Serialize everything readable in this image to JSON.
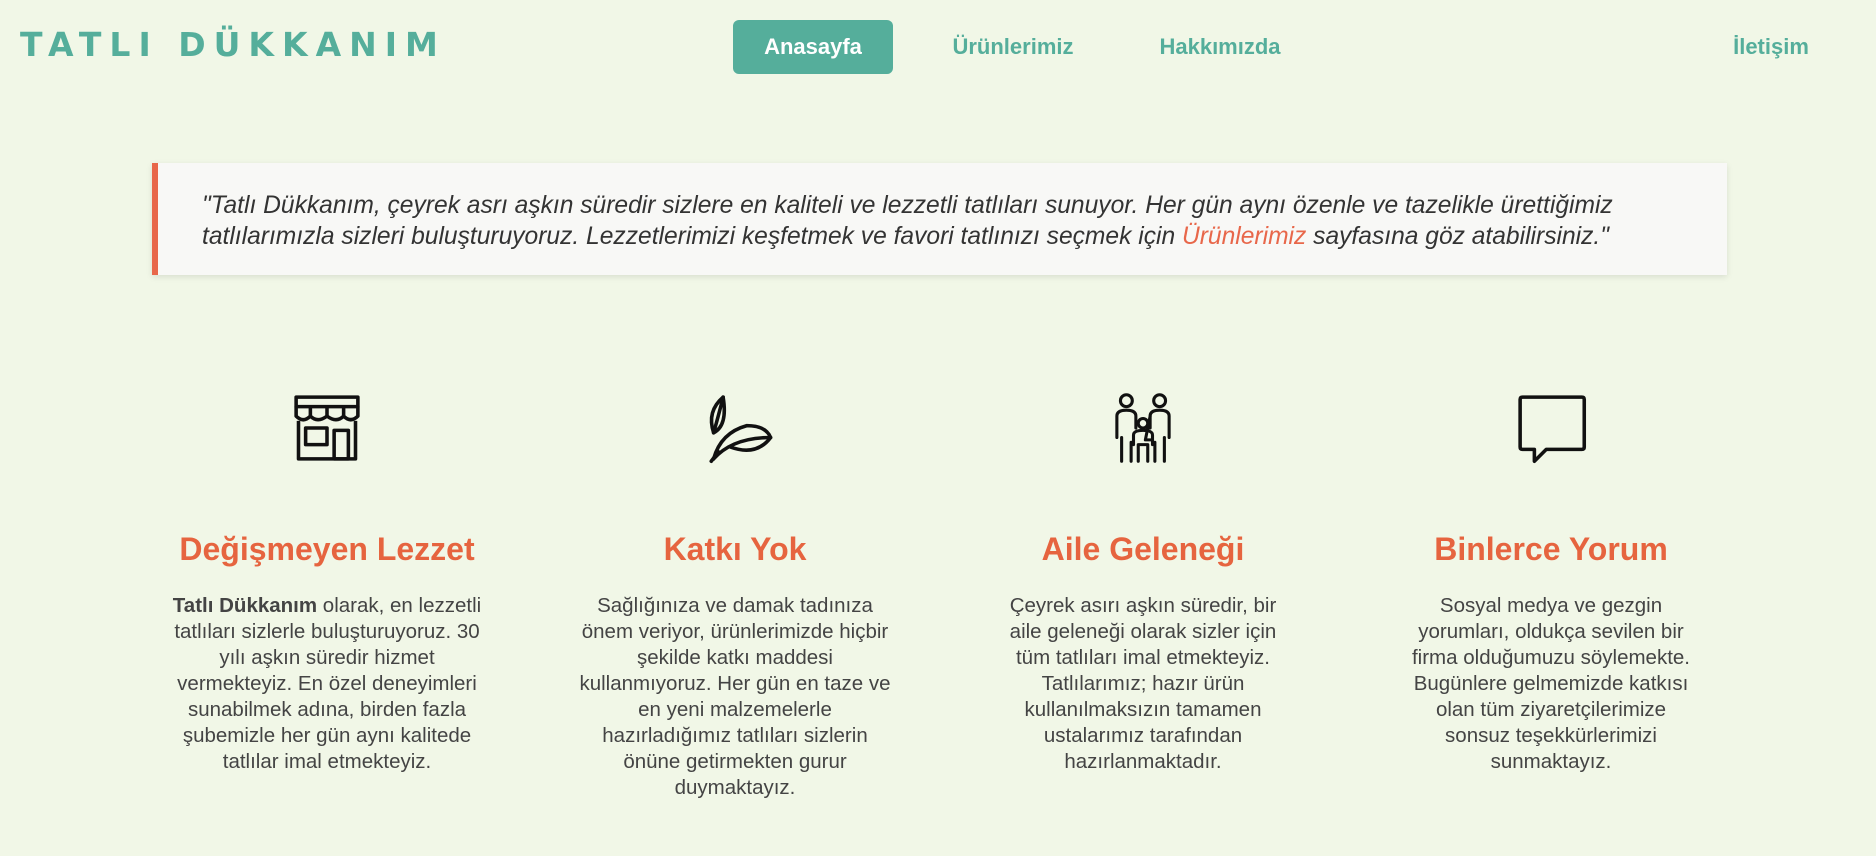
{
  "brand": {
    "name": "TATLI DÜKKANIM"
  },
  "nav": {
    "items": [
      {
        "label": "Anasayfa",
        "active": true
      },
      {
        "label": "Ürünlerimiz",
        "active": false
      },
      {
        "label": "Hakkımızda",
        "active": false
      },
      {
        "label": "İletişim",
        "active": false
      }
    ]
  },
  "quote": {
    "text_before": "\"Tatlı Dükkanım, çeyrek asrı aşkın süredir sizlere en kaliteli ve lezzetli tatlıları sunuyor. Her gün aynı özenle ve tazelikle ürettiğimiz tatlılarımızla sizleri buluşturuyoruz. Lezzetlerimizi keşfetmek ve favori tatlınızı seçmek için ",
    "link": "Ürünlerimiz",
    "text_after": " sayfasına göz atabilirsiniz.\""
  },
  "features": [
    {
      "icon": "store-icon",
      "title": "Değişmeyen Lezzet",
      "text_bold": "Tatlı Dükkanım",
      "text": " olarak, en lezzetli tatlıları sizlerle buluşturuyoruz. 30 yılı aşkın süredir hizmet vermekteyiz. En özel deneyimleri sunabilmek adına, birden fazla şubemizle her gün aynı kalitede tatlılar imal etmekteyiz."
    },
    {
      "icon": "leaf-icon",
      "title": "Katkı Yok",
      "text": "Sağlığınıza ve damak tadınıza önem veriyor, ürünlerimizde hiçbir şekilde katkı maddesi kullanmıyoruz. Her gün en taze ve en yeni malzemelerle hazırladığımız tatlıları sizlerin önüne getirmekten gurur duymaktayız."
    },
    {
      "icon": "family-icon",
      "title": "Aile Geleneği",
      "text": "Çeyrek asırı aşkın süredir, bir aile geleneği olarak sizler için tüm tatlıları imal etmekteyiz. Tatlılarımız; hazır ürün kullanılmaksızın tamamen ustalarımız tarafından hazırlanmaktadır."
    },
    {
      "icon": "chat-bubble-icon",
      "title": "Binlerce Yorum",
      "text": "Sosyal medya ve gezgin yorumları, oldukça sevilen bir firma olduğumuzu söylemekte. Bugünlere gelmemizde katkısı olan tüm ziyaretçilerimize sonsuz teşekkürlerimizi sunmaktayız."
    }
  ],
  "colors": {
    "background": "#f1f7e7",
    "primary": "#55ae9b",
    "accent": "#e6643f"
  }
}
